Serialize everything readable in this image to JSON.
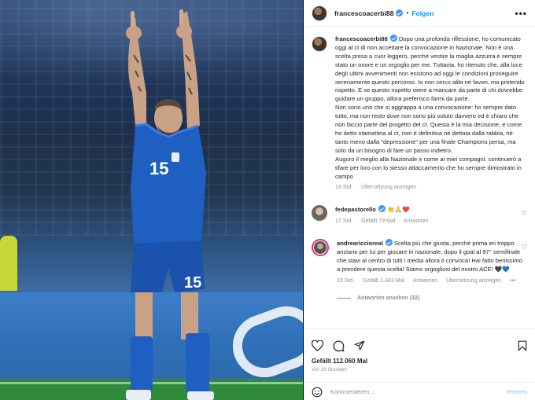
{
  "post": {
    "username": "francescoacerbi88",
    "separator": "•",
    "follow_label": "Folgen",
    "more_label": "•••",
    "caption_paragraphs": [
      "Dopo una profonda riflessione, ho comunicato oggi al ct di non accettare la convocazione in Nazionale. Non è una scelta presa a cuor leggero, perché vestire la maglia azzurra è sempre stato un onore e un orgoglio per me. Tuttavia, ho ritenuto che, alla luce degli ultimi avvenimenti non esistono ad oggi le condizioni proseguire serenamente questo percorso. Io non cerco alibi né favori, ma pretendo rispetto. E se questo rispetto viene a mancare da parte di chi dovrebbe guidare un gruppo, allora preferisco farmi da parte.",
      "Non sono uno che si aggrappa a una convocazione: ho sempre dato tutto, ma non resto dove non sono più voluto davvero ed è chiaro che non faccio parte del progetto del ct. Questa è la mia decisione, e come ho detto stamattina al ct, non è definitiva né dettata dalla rabbia, né tanto meno dalla \"depressione\" per una finale Champions persa, ma solo da un bisogno di fare un passo indietro.",
      "Auguro il meglio alla Nazionale e come ai miei compagni: continuerò a tifare per loro con lo stesso attaccamento che ho sempre dimostrato in campo"
    ],
    "caption_time": "19 Std.",
    "translate_label": "Übersetzung anzeigen",
    "likes_label": "Gefällt 112.060 Mal",
    "post_time": "Vor 19 Stunden",
    "comment_placeholder": "Kommentieren ...",
    "post_button": "Posten",
    "jersey_number": "15"
  },
  "comments": [
    {
      "username": "fedepastorello",
      "text": "👏🙏❤️",
      "time": "17 Std.",
      "likes": "Gefällt 79 Mal",
      "reply": "Antworten"
    },
    {
      "username": "andreariccioreal",
      "text": "Scelta più che giusta, perché prima eri troppo anziano per lui per giocare in nazionale, dopo il goal al 97° semifinale che stavi al centro di tutti i media allora ti convoca! Hai fatto benissimo a prendere questa scelta! Siamo orgogliosi del nostro ACE! 🖤💙",
      "time": "19 Std.",
      "likes": "Gefällt 1.343 Mal",
      "reply": "Antworten",
      "translate": "Übersetzung anzeigen",
      "more": "•••",
      "view_replies": "Antworten ansehen (32)"
    }
  ],
  "icons": {
    "like": "heart-icon",
    "comment": "comment-icon",
    "share": "share-icon",
    "save": "bookmark-icon",
    "emoji": "emoji-icon"
  },
  "colors": {
    "link_blue": "#0095f6",
    "muted": "#8e8e8e",
    "jersey": "#1f5fc2"
  }
}
